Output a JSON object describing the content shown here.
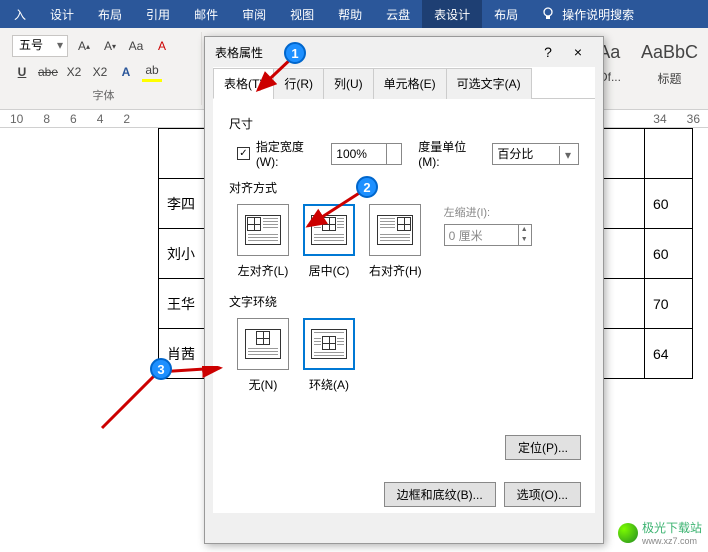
{
  "ribbon": {
    "tabs": [
      "入",
      "设计",
      "布局",
      "引用",
      "邮件",
      "审阅",
      "视图",
      "帮助",
      "云盘",
      "表设计",
      "布局"
    ],
    "active_index": 9,
    "tell_me": "操作说明搜索"
  },
  "toolbar": {
    "font_size": "五号",
    "group_label": "字体",
    "style1_preview": "Aa",
    "style1_label": "Of...",
    "style2_preview": "AaBbC",
    "style2_label": "标题"
  },
  "ruler": [
    "10",
    "8",
    "6",
    "4",
    "2",
    "",
    "34",
    "36"
  ],
  "table_rows": [
    {
      "name": "李四",
      "num": "60"
    },
    {
      "name": "刘小",
      "num": "60"
    },
    {
      "name": "王华",
      "num": "70"
    },
    {
      "name": "肖茜",
      "num": "64"
    }
  ],
  "dialog": {
    "title": "表格属性",
    "help": "?",
    "close": "×",
    "tabs": [
      "表格(T)",
      "行(R)",
      "列(U)",
      "单元格(E)",
      "可选文字(A)"
    ],
    "active_tab": 0,
    "size_label": "尺寸",
    "specify_width_check": "✓",
    "specify_width_label": "指定宽度(W):",
    "width_value": "100%",
    "unit_label": "度量单位(M):",
    "unit_value": "百分比",
    "align_label": "对齐方式",
    "align_opts": [
      "左对齐(L)",
      "居中(C)",
      "右对齐(H)"
    ],
    "align_selected": 1,
    "indent_label": "左缩进(I):",
    "indent_value": "0 厘米",
    "wrap_label": "文字环绕",
    "wrap_opts": [
      "无(N)",
      "环绕(A)"
    ],
    "wrap_selected": 1,
    "pos_btn": "定位(P)...",
    "borders_btn": "边框和底纹(B)...",
    "options_btn": "选项(O)..."
  },
  "callouts": {
    "c1": "1",
    "c2": "2",
    "c3": "3"
  },
  "watermark": {
    "name": "极光下载站",
    "url": "www.xz7.com"
  }
}
